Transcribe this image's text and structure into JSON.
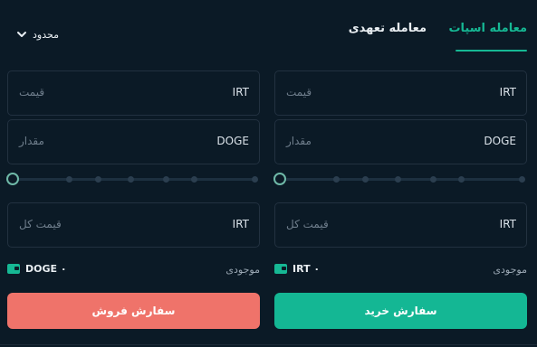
{
  "tabs": {
    "spot": "معامله اسپات",
    "futures": "معامله تعهدی"
  },
  "order_type": {
    "selected": "محدود"
  },
  "buy": {
    "price": {
      "placeholder": "قیمت",
      "unit": "IRT"
    },
    "amount": {
      "placeholder": "مقدار",
      "unit": "DOGE"
    },
    "total": {
      "placeholder": "قیمت کل",
      "unit": "IRT"
    },
    "slider_level": 0,
    "balance_label": "موجودی",
    "balance_value": "IRT ۰",
    "button": "سفارش خرید"
  },
  "sell": {
    "price": {
      "placeholder": "قیمت",
      "unit": "IRT"
    },
    "amount": {
      "placeholder": "مقدار",
      "unit": "DOGE"
    },
    "total": {
      "placeholder": "قیمت کل",
      "unit": "IRT"
    },
    "slider_level": 0,
    "balance_label": "موجودی",
    "balance_value": "DOGE ۰",
    "button": "سفارش فروش"
  },
  "colors": {
    "accent": "#16b894",
    "buy": "#14b794",
    "sell": "#ef736a",
    "background": "#0b1a26"
  },
  "icons": {
    "dropdown": "chevron-down-icon",
    "wallet": "wallet-icon"
  }
}
